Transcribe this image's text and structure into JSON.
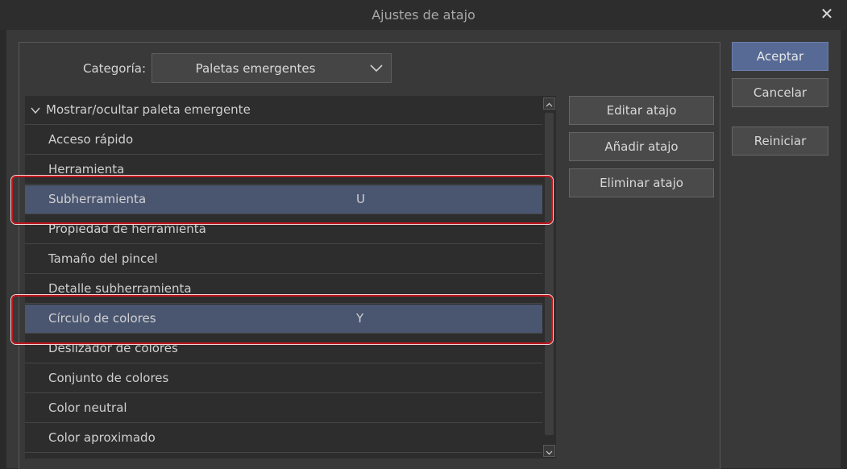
{
  "window": {
    "title": "Ajustes de atajo"
  },
  "category": {
    "label": "Categoría:",
    "value": "Paletas emergentes"
  },
  "list": {
    "group": "Mostrar/ocultar paleta emergente",
    "items": [
      {
        "label": "Acceso rápido",
        "key": ""
      },
      {
        "label": "Herramienta",
        "key": ""
      },
      {
        "label": "Subherramienta",
        "key": "U"
      },
      {
        "label": "Propiedad de herramienta",
        "key": ""
      },
      {
        "label": "Tamaño del pincel",
        "key": ""
      },
      {
        "label": "Detalle subherramienta",
        "key": ""
      },
      {
        "label": "Círculo de colores",
        "key": "Y"
      },
      {
        "label": "Deslizador de colores",
        "key": ""
      },
      {
        "label": "Conjunto de colores",
        "key": ""
      },
      {
        "label": "Color neutral",
        "key": ""
      },
      {
        "label": "Color aproximado",
        "key": ""
      }
    ]
  },
  "actions": {
    "edit": "Editar atajo",
    "add": "Añadir atajo",
    "delete": "Eliminar atajo"
  },
  "dialog_buttons": {
    "ok": "Aceptar",
    "cancel": "Cancelar",
    "reset": "Reiniciar"
  },
  "colors": {
    "selection": "#4a5570",
    "highlight": "#c0161e",
    "primary": "#566a95"
  }
}
